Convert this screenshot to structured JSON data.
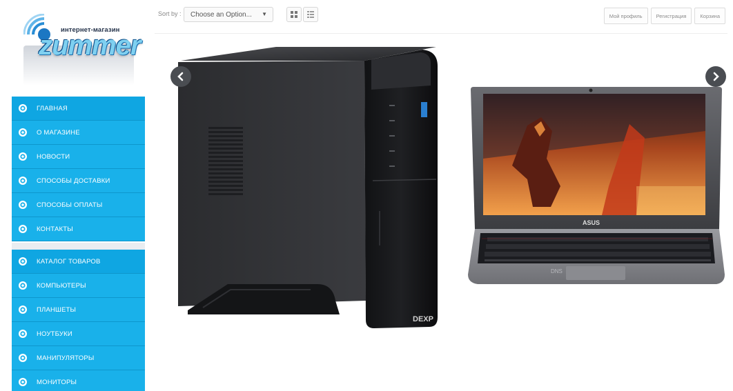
{
  "logo": {
    "tagline": "интернет-магазин",
    "brand": "zummer"
  },
  "sidebar": {
    "main_menu": [
      {
        "label": "ГЛАВНАЯ"
      },
      {
        "label": "О МАГАЗИНЕ"
      },
      {
        "label": "НОВОСТИ"
      },
      {
        "label": "СПОСОБЫ ДОСТАВКИ"
      },
      {
        "label": "СПОСОБЫ ОПЛАТЫ"
      },
      {
        "label": "КОНТАКТЫ"
      }
    ],
    "catalog_menu": [
      {
        "label": "КАТАЛОГ ТОВАРОВ"
      },
      {
        "label": "КОМПЬЮТЕРЫ"
      },
      {
        "label": "ПЛАНШЕТЫ"
      },
      {
        "label": "НОУТБУКИ"
      },
      {
        "label": "МАНИПУЛЯТОРЫ"
      },
      {
        "label": "МОНИТОРЫ"
      }
    ]
  },
  "toolbar": {
    "sort_label": "Sort by :",
    "sort_selected": "Choose an Option...",
    "grid_icon": "grid-view-icon",
    "list_icon": "list-view-icon"
  },
  "top_links": [
    {
      "label": "Мой профиль"
    },
    {
      "label": "Регистрация"
    },
    {
      "label": "Корзина"
    }
  ],
  "slider": {
    "pc_brand": "DEXP",
    "laptop_brand": "ASUS",
    "watermark": "DNS",
    "prev_icon": "chevron-left-icon",
    "next_icon": "chevron-right-icon"
  },
  "colors": {
    "menu_bg": "#19b1ea",
    "menu_border": "#0d96cc",
    "brand_blue": "#7fd0f0",
    "arrow_bg": "#4a4d52"
  }
}
